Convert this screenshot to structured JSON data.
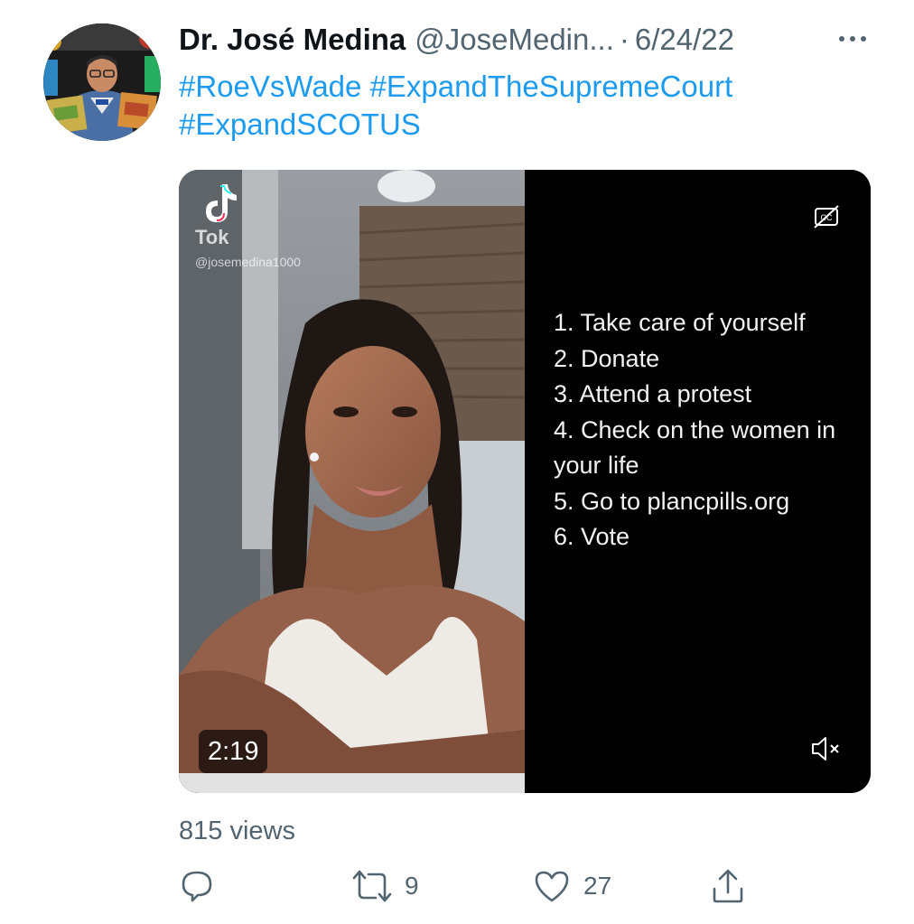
{
  "tweet": {
    "display_name": "Dr. José Medina",
    "handle": "@JoseMedin...",
    "separator": "·",
    "date": "6/24/22",
    "hashtags": [
      "#RoeVsWade #ExpandTheSupremeCourt",
      "#ExpandSCOTUS"
    ],
    "views": "815 views"
  },
  "media": {
    "duration": "2:19",
    "watermark_app": "Tok",
    "watermark_user": "@josemedina1000",
    "steps": [
      "1. Take care of yourself",
      "2. Donate",
      "3. Attend a protest",
      "4. Check on the women in",
      "your life",
      "5. Go to plancpills.org",
      "6. Vote"
    ],
    "icons": {
      "captions": "closed-captions-off-icon",
      "mute": "volume-muted-icon",
      "tiktok": "tiktok-logo-icon"
    }
  },
  "actions": {
    "reply_count": "",
    "retweet_count": "9",
    "like_count": "27",
    "share_count": "",
    "icons": [
      "reply-icon",
      "retweet-icon",
      "like-icon",
      "share-icon"
    ]
  },
  "colors": {
    "accent": "#1d9bf0",
    "secondary_text": "#536471",
    "primary_text": "#0f1419"
  }
}
